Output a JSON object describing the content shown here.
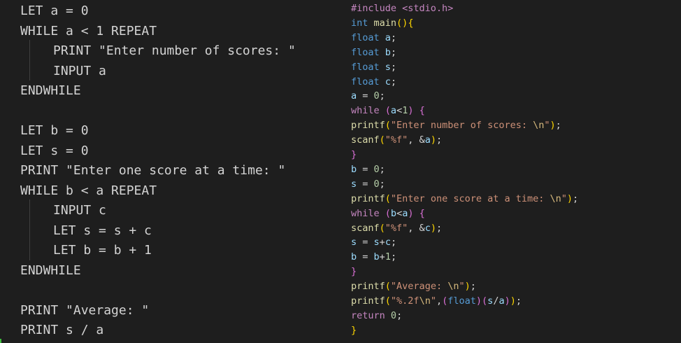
{
  "pseudocode": {
    "lines": [
      {
        "text": "LET a = 0",
        "indent": false
      },
      {
        "text": "WHILE a < 1 REPEAT",
        "indent": false
      },
      {
        "text": "PRINT \"Enter number of scores: \"",
        "indent": true
      },
      {
        "text": "INPUT a",
        "indent": true
      },
      {
        "text": "ENDWHILE",
        "indent": false
      },
      {
        "text": "",
        "indent": false
      },
      {
        "text": "LET b = 0",
        "indent": false
      },
      {
        "text": "LET s = 0",
        "indent": false
      },
      {
        "text": "PRINT \"Enter one score at a time: \"",
        "indent": false
      },
      {
        "text": "WHILE b < a REPEAT",
        "indent": false
      },
      {
        "text": "INPUT c",
        "indent": true
      },
      {
        "text": "LET s = s + c",
        "indent": true
      },
      {
        "text": "LET b = b + 1",
        "indent": true
      },
      {
        "text": "ENDWHILE",
        "indent": false
      },
      {
        "text": "",
        "indent": false
      },
      {
        "text": "PRINT \"Average: \"",
        "indent": false
      },
      {
        "text": "PRINT s / a",
        "indent": false
      }
    ]
  },
  "c_code": {
    "lines": [
      [
        {
          "t": "#include <stdio.h>",
          "c": "inc"
        }
      ],
      [
        {
          "t": "int",
          "c": "kw"
        },
        {
          "t": " "
        },
        {
          "t": "main",
          "c": "fn"
        },
        {
          "t": "()",
          "c": "paren"
        },
        {
          "t": "{",
          "c": "paren"
        }
      ],
      [
        {
          "t": "float",
          "c": "kw"
        },
        {
          "t": " "
        },
        {
          "t": "a",
          "c": "var"
        },
        {
          "t": ";"
        }
      ],
      [
        {
          "t": "float",
          "c": "kw"
        },
        {
          "t": " "
        },
        {
          "t": "b",
          "c": "var"
        },
        {
          "t": ";"
        }
      ],
      [
        {
          "t": "float",
          "c": "kw"
        },
        {
          "t": " "
        },
        {
          "t": "s",
          "c": "var"
        },
        {
          "t": ";"
        }
      ],
      [
        {
          "t": "float",
          "c": "kw"
        },
        {
          "t": " "
        },
        {
          "t": "c",
          "c": "var"
        },
        {
          "t": ";"
        }
      ],
      [
        {
          "t": "a",
          "c": "var"
        },
        {
          "t": " = "
        },
        {
          "t": "0",
          "c": "num"
        },
        {
          "t": ";"
        }
      ],
      [
        {
          "t": "while",
          "c": "ctl"
        },
        {
          "t": " "
        },
        {
          "t": "(",
          "c": "brace"
        },
        {
          "t": "a",
          "c": "var"
        },
        {
          "t": "<"
        },
        {
          "t": "1",
          "c": "num"
        },
        {
          "t": ")",
          "c": "brace"
        },
        {
          "t": " "
        },
        {
          "t": "{",
          "c": "brace"
        }
      ],
      [
        {
          "t": "printf",
          "c": "fn"
        },
        {
          "t": "(",
          "c": "paren"
        },
        {
          "t": "\"Enter number of scores: ",
          "c": "str"
        },
        {
          "t": "\\n",
          "c": "esc"
        },
        {
          "t": "\"",
          "c": "str"
        },
        {
          "t": ")",
          "c": "paren"
        },
        {
          "t": ";"
        }
      ],
      [
        {
          "t": "scanf",
          "c": "fn"
        },
        {
          "t": "(",
          "c": "paren"
        },
        {
          "t": "\"%f\"",
          "c": "str"
        },
        {
          "t": ", &"
        },
        {
          "t": "a",
          "c": "var"
        },
        {
          "t": ")",
          "c": "paren"
        },
        {
          "t": ";"
        }
      ],
      [
        {
          "t": "}",
          "c": "brace"
        }
      ],
      [
        {
          "t": "b",
          "c": "var"
        },
        {
          "t": " = "
        },
        {
          "t": "0",
          "c": "num"
        },
        {
          "t": ";"
        }
      ],
      [
        {
          "t": "s",
          "c": "var"
        },
        {
          "t": " = "
        },
        {
          "t": "0",
          "c": "num"
        },
        {
          "t": ";"
        }
      ],
      [
        {
          "t": "printf",
          "c": "fn"
        },
        {
          "t": "(",
          "c": "paren"
        },
        {
          "t": "\"Enter one score at a time: ",
          "c": "str"
        },
        {
          "t": "\\n",
          "c": "esc"
        },
        {
          "t": "\"",
          "c": "str"
        },
        {
          "t": ")",
          "c": "paren"
        },
        {
          "t": ";"
        }
      ],
      [
        {
          "t": "while",
          "c": "ctl"
        },
        {
          "t": " "
        },
        {
          "t": "(",
          "c": "brace"
        },
        {
          "t": "b",
          "c": "var"
        },
        {
          "t": "<"
        },
        {
          "t": "a",
          "c": "var"
        },
        {
          "t": ")",
          "c": "brace"
        },
        {
          "t": " "
        },
        {
          "t": "{",
          "c": "brace"
        }
      ],
      [
        {
          "t": "scanf",
          "c": "fn"
        },
        {
          "t": "(",
          "c": "paren"
        },
        {
          "t": "\"%f\"",
          "c": "str"
        },
        {
          "t": ", &"
        },
        {
          "t": "c",
          "c": "var"
        },
        {
          "t": ")",
          "c": "paren"
        },
        {
          "t": ";"
        }
      ],
      [
        {
          "t": "s",
          "c": "var"
        },
        {
          "t": " = "
        },
        {
          "t": "s",
          "c": "var"
        },
        {
          "t": "+"
        },
        {
          "t": "c",
          "c": "var"
        },
        {
          "t": ";"
        }
      ],
      [
        {
          "t": "b",
          "c": "var"
        },
        {
          "t": " = "
        },
        {
          "t": "b",
          "c": "var"
        },
        {
          "t": "+"
        },
        {
          "t": "1",
          "c": "num"
        },
        {
          "t": ";"
        }
      ],
      [
        {
          "t": "}",
          "c": "brace"
        }
      ],
      [
        {
          "t": "printf",
          "c": "fn"
        },
        {
          "t": "(",
          "c": "paren"
        },
        {
          "t": "\"Average: ",
          "c": "str"
        },
        {
          "t": "\\n",
          "c": "esc"
        },
        {
          "t": "\"",
          "c": "str"
        },
        {
          "t": ")",
          "c": "paren"
        },
        {
          "t": ";"
        }
      ],
      [
        {
          "t": "printf",
          "c": "fn"
        },
        {
          "t": "(",
          "c": "paren"
        },
        {
          "t": "\"%.2f",
          "c": "str"
        },
        {
          "t": "\\n",
          "c": "esc"
        },
        {
          "t": "\"",
          "c": "str"
        },
        {
          "t": ","
        },
        {
          "t": "(",
          "c": "brace"
        },
        {
          "t": "float",
          "c": "kw"
        },
        {
          "t": ")",
          "c": "brace"
        },
        {
          "t": "(",
          "c": "brace"
        },
        {
          "t": "s",
          "c": "var"
        },
        {
          "t": "/"
        },
        {
          "t": "a",
          "c": "var"
        },
        {
          "t": ")",
          "c": "brace"
        },
        {
          "t": ")",
          "c": "paren"
        },
        {
          "t": ";"
        }
      ],
      [
        {
          "t": "return",
          "c": "ctl"
        },
        {
          "t": " "
        },
        {
          "t": "0",
          "c": "num"
        },
        {
          "t": ";"
        }
      ],
      [
        {
          "t": "}",
          "c": "paren"
        }
      ]
    ]
  },
  "colors": {
    "background": "#1e1e1e",
    "text": "#d4d4d4",
    "keyword": "#569cd6",
    "control": "#c586c0",
    "function": "#dcdcaa",
    "string": "#ce9178",
    "escape": "#d7ba7d",
    "number": "#b5cea8",
    "variable": "#9cdcfe",
    "bracket_gold": "#ffd700",
    "bracket_purple": "#da70d6"
  }
}
